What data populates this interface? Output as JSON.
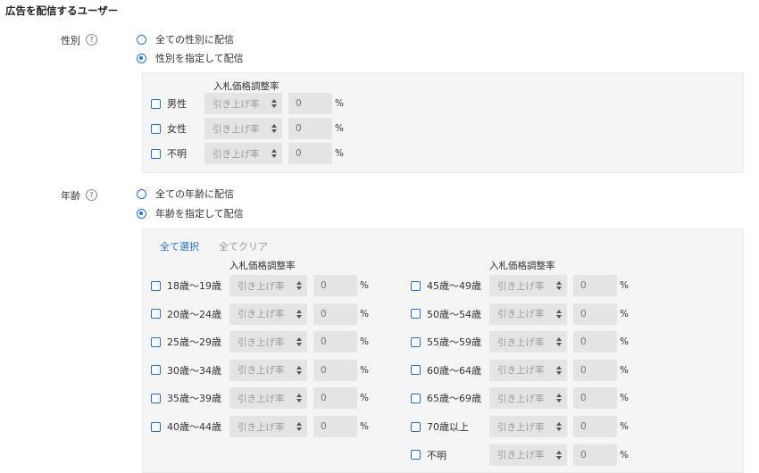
{
  "section_title": "広告を配信するユーザー",
  "help_glyph": "?",
  "gender": {
    "label": "性別",
    "options": [
      {
        "label": "全ての性別に配信",
        "checked": false
      },
      {
        "label": "性別を指定して配信",
        "checked": true
      }
    ],
    "column_header": "入札価格調整率",
    "rows": [
      {
        "label": "男性",
        "select": "引き上げ率",
        "value": "0",
        "unit": "%"
      },
      {
        "label": "女性",
        "select": "引き上げ率",
        "value": "0",
        "unit": "%"
      },
      {
        "label": "不明",
        "select": "引き上げ率",
        "value": "0",
        "unit": "%"
      }
    ]
  },
  "age": {
    "label": "年齢",
    "options": [
      {
        "label": "全ての年齢に配信",
        "checked": false
      },
      {
        "label": "年齢を指定して配信",
        "checked": true
      }
    ],
    "select_all": "全て選択",
    "clear_all": "全てクリア",
    "column_header": "入札価格調整率",
    "left_rows": [
      {
        "label": "18歳～19歳",
        "select": "引き上げ率",
        "value": "0",
        "unit": "%"
      },
      {
        "label": "20歳～24歳",
        "select": "引き上げ率",
        "value": "0",
        "unit": "%"
      },
      {
        "label": "25歳～29歳",
        "select": "引き上げ率",
        "value": "0",
        "unit": "%"
      },
      {
        "label": "30歳～34歳",
        "select": "引き上げ率",
        "value": "0",
        "unit": "%"
      },
      {
        "label": "35歳～39歳",
        "select": "引き上げ率",
        "value": "0",
        "unit": "%"
      },
      {
        "label": "40歳～44歳",
        "select": "引き上げ率",
        "value": "0",
        "unit": "%"
      }
    ],
    "right_rows": [
      {
        "label": "45歳～49歳",
        "select": "引き上げ率",
        "value": "0",
        "unit": "%"
      },
      {
        "label": "50歳～54歳",
        "select": "引き上げ率",
        "value": "0",
        "unit": "%"
      },
      {
        "label": "55歳～59歳",
        "select": "引き上げ率",
        "value": "0",
        "unit": "%"
      },
      {
        "label": "60歳～64歳",
        "select": "引き上げ率",
        "value": "0",
        "unit": "%"
      },
      {
        "label": "65歳～69歳",
        "select": "引き上げ率",
        "value": "0",
        "unit": "%"
      },
      {
        "label": "70歳以上",
        "select": "引き上げ率",
        "value": "0",
        "unit": "%"
      },
      {
        "label": "不明",
        "select": "引き上げ率",
        "value": "0",
        "unit": "%"
      }
    ]
  },
  "colors": {
    "accent": "#2a6fc9",
    "panel_bg": "#f5f5f5",
    "input_bg": "#e4e4e4"
  }
}
